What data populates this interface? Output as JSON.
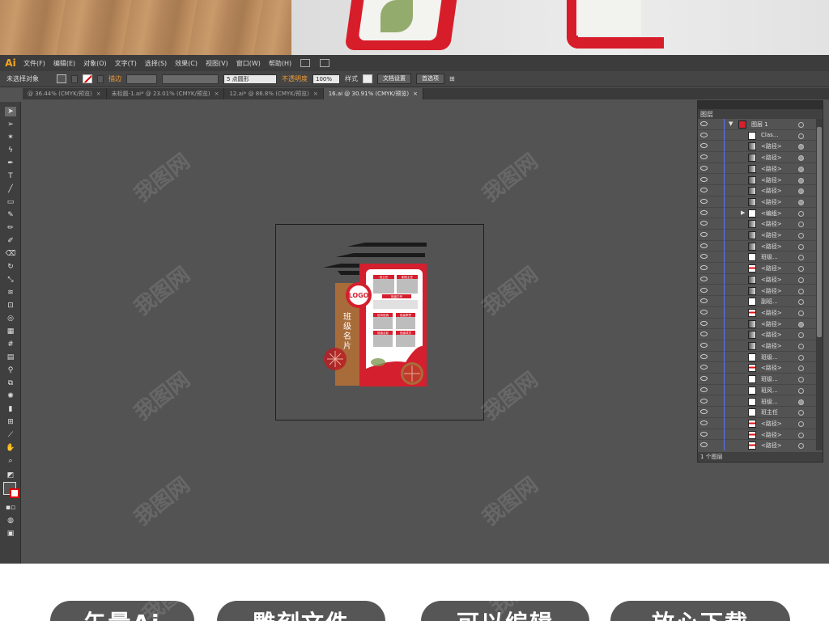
{
  "colors": {
    "ai_logo": "#f7a51c",
    "canvas_bg": "#535353",
    "accent_orange": "#f29c38",
    "board_red": "#d41f2e",
    "board_brown": "#a86c3a"
  },
  "app": {
    "logo": "Ai",
    "menus": [
      "文件(F)",
      "编辑(E)",
      "对象(O)",
      "文字(T)",
      "选择(S)",
      "效果(C)",
      "视图(V)",
      "窗口(W)",
      "帮助(H)"
    ]
  },
  "control_bar": {
    "selection_status": "未选择对象",
    "stroke_label": "描边",
    "brush_value": "5 点圆形",
    "opacity_label": "不透明度",
    "opacity_value": "100%",
    "style_label": "样式",
    "doc_setup_button": "文档设置",
    "preferences_button": "首选项"
  },
  "tabs": [
    {
      "label": "@ 36.44% (CMYK/预览)",
      "close": "×",
      "active": false
    },
    {
      "label": "未标题-1.ai* @ 23.01% (CMYK/预览)",
      "close": "×",
      "active": false
    },
    {
      "label": "12.ai* @ 86.8% (CMYK/预览)",
      "close": "×",
      "active": false
    },
    {
      "label": "16.ai @ 30.91% (CMYK/预览)",
      "close": "×",
      "active": true
    }
  ],
  "artwork": {
    "logo_text": "LOGO",
    "vertical_title": [
      "班",
      "级",
      "名",
      "片"
    ],
    "red_labels": [
      "班主任",
      "副班主任",
      "班级口号",
      "班风班貌",
      "班级荣誉",
      "班级合影",
      "班级成员"
    ]
  },
  "layers_panel": {
    "title": "图层",
    "footer": "1 个图层",
    "rows": [
      {
        "label": "图层 1",
        "type": "layer",
        "thumb": "layer",
        "filled": false
      },
      {
        "label": "Clas...",
        "type": "item",
        "thumb": "white",
        "filled": false
      },
      {
        "label": "<路径>",
        "type": "item",
        "thumb": "grad",
        "filled": true
      },
      {
        "label": "<路径>",
        "type": "item",
        "thumb": "grad",
        "filled": true
      },
      {
        "label": "<路径>",
        "type": "item",
        "thumb": "grad",
        "filled": true
      },
      {
        "label": "<路径>",
        "type": "item",
        "thumb": "grad",
        "filled": true
      },
      {
        "label": "<路径>",
        "type": "item",
        "thumb": "grad",
        "filled": true
      },
      {
        "label": "<路径>",
        "type": "item",
        "thumb": "grad",
        "filled": true
      },
      {
        "label": "<编组>",
        "type": "group",
        "thumb": "white",
        "filled": false
      },
      {
        "label": "<路径>",
        "type": "item",
        "thumb": "grad",
        "filled": false
      },
      {
        "label": "<路径>",
        "type": "item",
        "thumb": "grad",
        "filled": false
      },
      {
        "label": "<路径>",
        "type": "item",
        "thumb": "grad",
        "filled": false
      },
      {
        "label": "班级...",
        "type": "item",
        "thumb": "white",
        "filled": false
      },
      {
        "label": "<路径>",
        "type": "item",
        "thumb": "striped",
        "filled": false
      },
      {
        "label": "<路径>",
        "type": "item",
        "thumb": "grad",
        "filled": false
      },
      {
        "label": "<路径>",
        "type": "item",
        "thumb": "grad",
        "filled": false
      },
      {
        "label": "副班...",
        "type": "item",
        "thumb": "white",
        "filled": false
      },
      {
        "label": "<路径>",
        "type": "item",
        "thumb": "striped",
        "filled": false
      },
      {
        "label": "<路径>",
        "type": "item",
        "thumb": "grad",
        "filled": true
      },
      {
        "label": "<路径>",
        "type": "item",
        "thumb": "grad",
        "filled": false
      },
      {
        "label": "<路径>",
        "type": "item",
        "thumb": "grad",
        "filled": false
      },
      {
        "label": "班级...",
        "type": "item",
        "thumb": "white",
        "filled": false
      },
      {
        "label": "<路径>",
        "type": "item",
        "thumb": "striped",
        "filled": false
      },
      {
        "label": "班级...",
        "type": "item",
        "thumb": "white",
        "filled": false
      },
      {
        "label": "班风...",
        "type": "item",
        "thumb": "white",
        "filled": false
      },
      {
        "label": "班级...",
        "type": "item",
        "thumb": "white",
        "filled": true
      },
      {
        "label": "班主任",
        "type": "item",
        "thumb": "white",
        "filled": false
      },
      {
        "label": "<路径>",
        "type": "item",
        "thumb": "striped",
        "filled": false
      },
      {
        "label": "<路径>",
        "type": "item",
        "thumb": "striped",
        "filled": false
      },
      {
        "label": "<路径>",
        "type": "item",
        "thumb": "striped",
        "filled": false
      }
    ]
  },
  "bottom_pills": [
    "矢量Ai",
    "雕刻文件",
    "可以编辑",
    "放心下载"
  ],
  "watermark": "我图网"
}
